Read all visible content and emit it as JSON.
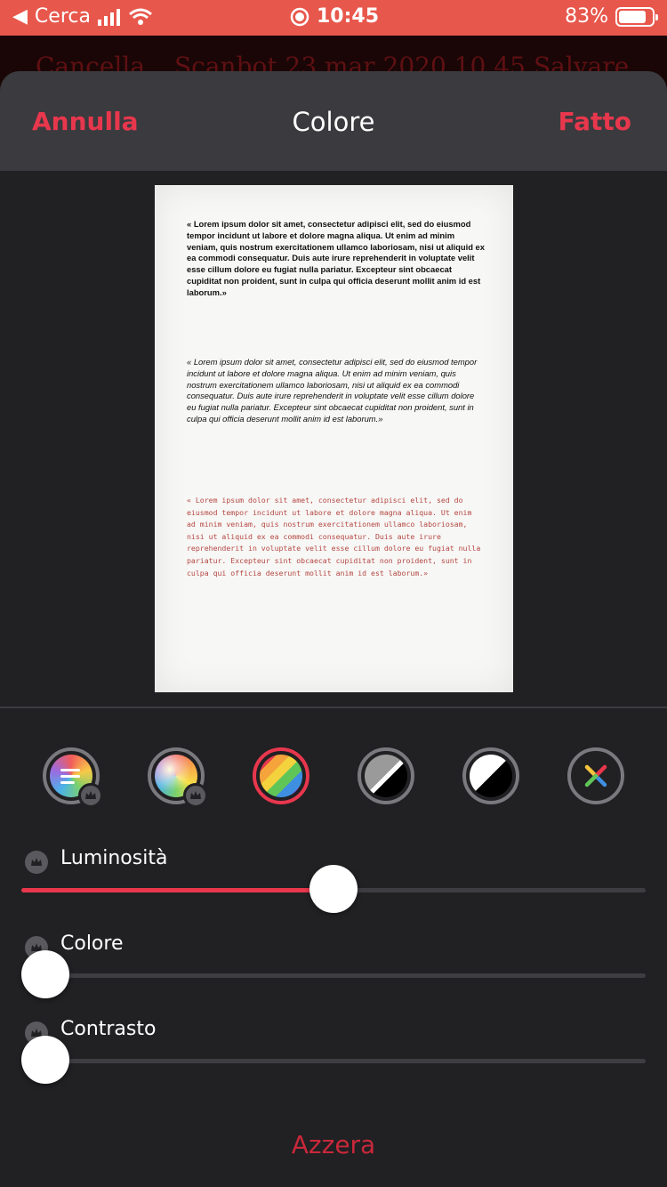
{
  "status_bar": {
    "back_label": "Cerca",
    "time": "10:45",
    "battery_percent": "83%",
    "battery_level": 0.83
  },
  "background_nav": {
    "left": "Cancella",
    "title": "Scanbot 23 mar 2020 10.45",
    "right": "Salvare"
  },
  "header": {
    "cancel": "Annulla",
    "title": "Colore",
    "done": "Fatto"
  },
  "document": {
    "para1": "« Lorem ipsum dolor sit amet, consectetur adipisci elit, sed do eiusmod tempor incidunt ut labore et dolore magna aliqua. Ut enim ad minim veniam, quis nostrum exercitationem ullamco laboriosam, nisi ut aliquid ex ea commodi consequatur. Duis aute irure reprehenderit in voluptate velit esse cillum dolore eu fugiat nulla pariatur. Excepteur sint obcaecat cupiditat non proident, sunt in culpa qui officia deserunt mollit anim id est laborum.»",
    "para2": "« Lorem ipsum dolor sit amet, consectetur adipisci elit, sed do eiusmod tempor incidunt ut labore et dolore magna aliqua. Ut enim ad minim veniam, quis nostrum exercitationem ullamco laboriosam, nisi ut aliquid ex ea commodi consequatur. Duis aute irure reprehenderit in voluptate velit esse cillum dolore eu fugiat nulla pariatur. Excepteur sint obcaecat cupiditat non proident, sunt in culpa qui officia deserunt mollit anim id est laborum.»",
    "para3": "« Lorem ipsum dolor sit amet, consectetur adipisci elit, sed do eiusmod tempor incidunt ut labore et dolore magna aliqua. Ut enim ad minim veniam, quis nostrum exercitationem ullamco laboriosam, nisi ut aliquid ex ea commodi consequatur. Duis aute irure reprehenderit in voluptate velit esse cillum dolore eu fugiat nulla pariatur. Excepteur sint obcaecat cupiditat non proident, sunt in culpa qui officia deserunt mollit anim id est laborum.»"
  },
  "filters": [
    {
      "icon": "color-document-filter-icon",
      "premium": true,
      "selected": false
    },
    {
      "icon": "color-gradient-filter-icon",
      "premium": true,
      "selected": false
    },
    {
      "icon": "rainbow-filter-icon",
      "premium": false,
      "selected": true
    },
    {
      "icon": "grayscale-filter-icon",
      "premium": false,
      "selected": false
    },
    {
      "icon": "black-white-filter-icon",
      "premium": false,
      "selected": false
    },
    {
      "icon": "no-filter-icon",
      "premium": false,
      "selected": false
    }
  ],
  "sliders": {
    "brightness": {
      "label": "Luminosità",
      "value": 0.5
    },
    "color": {
      "label": "Colore",
      "value": 0.0
    },
    "contrast": {
      "label": "Contrasto",
      "value": 0.0
    }
  },
  "reset_label": "Azzera",
  "colors": {
    "accent": "#e8374d",
    "status_bar": "#e8574c",
    "sheet_bg": "#212023",
    "header_bg": "#3b3a3e"
  }
}
